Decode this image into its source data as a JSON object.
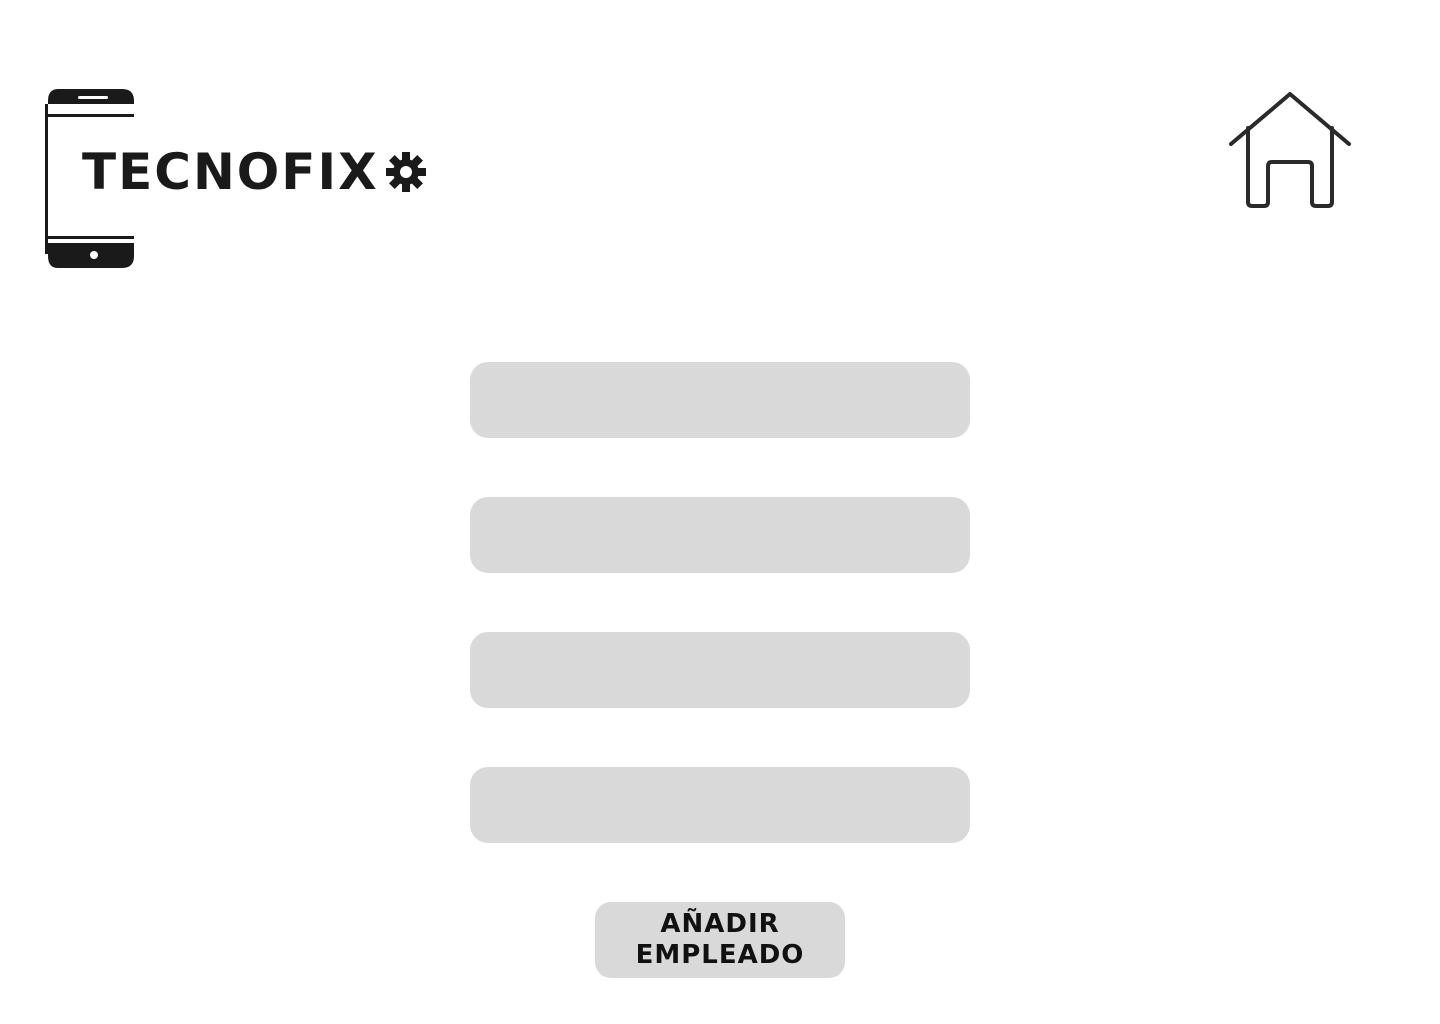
{
  "brand": {
    "name": "TECNOFIX",
    "logo_icon": "phone-gear-logo"
  },
  "header": {
    "home_icon": "home-icon"
  },
  "form": {
    "fields": [
      {
        "value": "",
        "placeholder": ""
      },
      {
        "value": "",
        "placeholder": ""
      },
      {
        "value": "",
        "placeholder": ""
      },
      {
        "value": "",
        "placeholder": ""
      }
    ],
    "submit_line1": "AÑADIR",
    "submit_line2": "EMPLEADO"
  },
  "colors": {
    "field_bg": "#d9d9d9",
    "ink": "#1a1a1a",
    "background": "#ffffff"
  }
}
